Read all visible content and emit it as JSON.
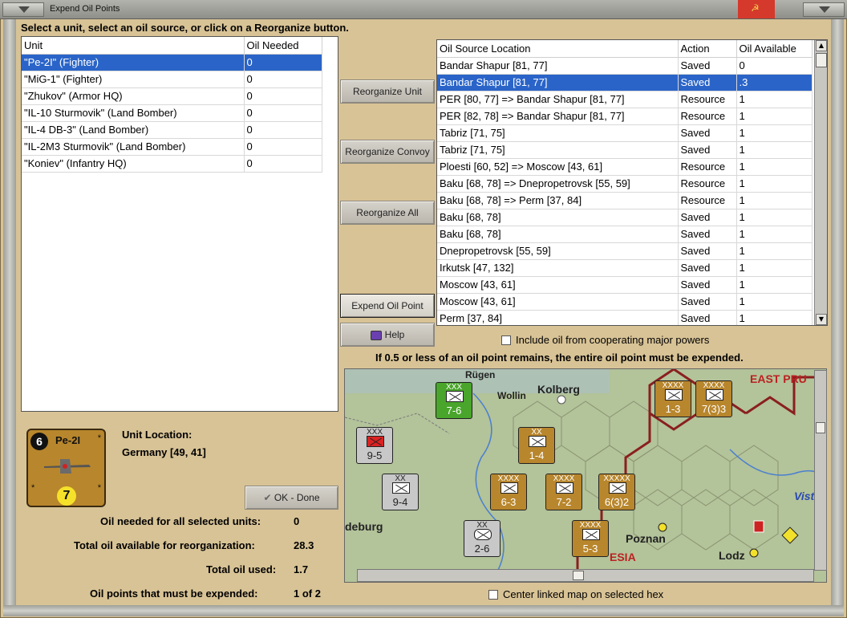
{
  "window": {
    "title": "Expend Oil Points"
  },
  "instruction": "Select a unit, select an oil source, or click on a Reorganize button.",
  "units": {
    "columns": [
      "Unit",
      "Oil Needed"
    ],
    "rows": [
      {
        "unit": "\"Pe-2I\" (Fighter)",
        "oil": "0",
        "selected": true
      },
      {
        "unit": "\"MiG-1\" (Fighter)",
        "oil": "0"
      },
      {
        "unit": "\"Zhukov\" (Armor HQ)",
        "oil": "0"
      },
      {
        "unit": "\"IL-10 Sturmovik\" (Land Bomber)",
        "oil": "0"
      },
      {
        "unit": "\"IL-4 DB-3\" (Land Bomber)",
        "oil": "0"
      },
      {
        "unit": "\"IL-2M3 Sturmovik\" (Land Bomber)",
        "oil": "0"
      },
      {
        "unit": "\"Koniev\" (Infantry HQ)",
        "oil": "0"
      }
    ]
  },
  "buttons": {
    "reorganize_unit": "Reorganize Unit",
    "reorganize_convoy": "Reorganize Convoy",
    "reorganize_all": "Reorganize All",
    "expend_oil_point": "Expend Oil Point",
    "help": "Help",
    "ok_done": "OK - Done"
  },
  "sources": {
    "columns": [
      "Oil Source Location",
      "Action",
      "Oil Available"
    ],
    "rows": [
      {
        "loc": "Bandar Shapur [81, 77]",
        "action": "Saved",
        "avail": "0"
      },
      {
        "loc": "Bandar Shapur [81, 77]",
        "action": "Saved",
        "avail": ".3",
        "selected": true
      },
      {
        "loc": "PER [80, 77] => Bandar Shapur [81, 77]",
        "action": "Resource",
        "avail": "1"
      },
      {
        "loc": "PER [82, 78] => Bandar Shapur [81, 77]",
        "action": "Resource",
        "avail": "1"
      },
      {
        "loc": "Tabriz [71, 75]",
        "action": "Saved",
        "avail": "1"
      },
      {
        "loc": "Tabriz [71, 75]",
        "action": "Saved",
        "avail": "1"
      },
      {
        "loc": "Ploesti [60, 52] => Moscow [43, 61]",
        "action": "Resource",
        "avail": "1"
      },
      {
        "loc": "Baku [68, 78] => Dnepropetrovsk [55, 59]",
        "action": "Resource",
        "avail": "1"
      },
      {
        "loc": "Baku [68, 78] => Perm [37, 84]",
        "action": "Resource",
        "avail": "1"
      },
      {
        "loc": "Baku [68, 78]",
        "action": "Saved",
        "avail": "1"
      },
      {
        "loc": "Baku [68, 78]",
        "action": "Saved",
        "avail": "1"
      },
      {
        "loc": "Dnepropetrovsk [55, 59]",
        "action": "Saved",
        "avail": "1"
      },
      {
        "loc": "Irkutsk [47, 132]",
        "action": "Saved",
        "avail": "1"
      },
      {
        "loc": "Moscow [43, 61]",
        "action": "Saved",
        "avail": "1"
      },
      {
        "loc": "Moscow [43, 61]",
        "action": "Saved",
        "avail": "1"
      },
      {
        "loc": "Perm [37, 84]",
        "action": "Saved",
        "avail": "1"
      }
    ]
  },
  "include_cooperating": "Include oil from cooperating major powers",
  "expend_note": "If 0.5 or less of an oil point remains, the entire oil point must be expended.",
  "center_map": "Center linked map on selected hex",
  "selected_unit": {
    "badge": "6",
    "name": "Pe-2I",
    "rating": "7",
    "location_label": "Unit Location:",
    "location_value": "Germany [49, 41]"
  },
  "summary": {
    "oil_needed_label": "Oil needed for all selected units:",
    "oil_needed_value": "0",
    "total_available_label": "Total oil available for reorganization:",
    "total_available_value": "28.3",
    "total_used_label": "Total oil used:",
    "total_used_value": "1.7",
    "must_expend_label": "Oil points that must be expended:",
    "must_expend_value": "1 of 2"
  },
  "map": {
    "place_labels": [
      "Rügen",
      "Wollin",
      "Kolberg",
      "EAST PRU",
      "Poznan",
      "Lodz",
      "Vist",
      "deburg",
      "ESIA"
    ],
    "counters": [
      {
        "top": "XXX",
        "val": "7-6"
      },
      {
        "top": "XXXX",
        "val": "1-3"
      },
      {
        "top": "XXXX",
        "val": "7(3)3"
      },
      {
        "top": "XXX",
        "val": "9-5"
      },
      {
        "top": "XX",
        "val": "1-4"
      },
      {
        "top": "XX",
        "val": "9-4"
      },
      {
        "top": "XXXX",
        "val": "6-3"
      },
      {
        "top": "XXXX",
        "val": "7-2"
      },
      {
        "top": "XXXXX",
        "val": "6(3)2"
      },
      {
        "top": "XX",
        "val": "2-6"
      },
      {
        "top": "XXXX",
        "val": "5-3"
      }
    ]
  }
}
